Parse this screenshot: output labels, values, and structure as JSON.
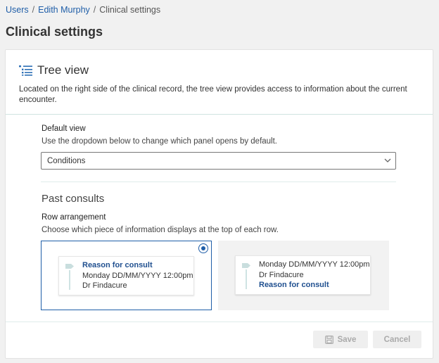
{
  "breadcrumb": {
    "items": [
      "Users",
      "Edith Murphy",
      "Clinical settings"
    ],
    "separator": "/"
  },
  "page": {
    "title": "Clinical settings"
  },
  "tree_view": {
    "title": "Tree view",
    "icon": "list-tree-icon",
    "description": "Located on the right side of the clinical record, the tree view provides access to information about the current encounter."
  },
  "default_view": {
    "label": "Default view",
    "help": "Use the dropdown below to change which panel opens by default.",
    "selected": "Conditions"
  },
  "past_consults": {
    "title": "Past consults",
    "row_arrangement_label": "Row arrangement",
    "row_arrangement_help": "Choose which piece of information displays at the top of each row.",
    "options": [
      {
        "line1": "Reason for consult",
        "line2": "Monday DD/MM/YYYY 12:00pm",
        "line3": "Dr Findacure",
        "selected": true
      },
      {
        "line1": "Monday DD/MM/YYYY 12:00pm",
        "line2": "Dr Findacure",
        "line3": "Reason for consult",
        "selected": false
      }
    ]
  },
  "footer": {
    "save_label": "Save",
    "cancel_label": "Cancel"
  },
  "colors": {
    "accent": "#1f5ea8",
    "teal_line": "#cfe3e1",
    "disabled_btn": "#efefef"
  }
}
